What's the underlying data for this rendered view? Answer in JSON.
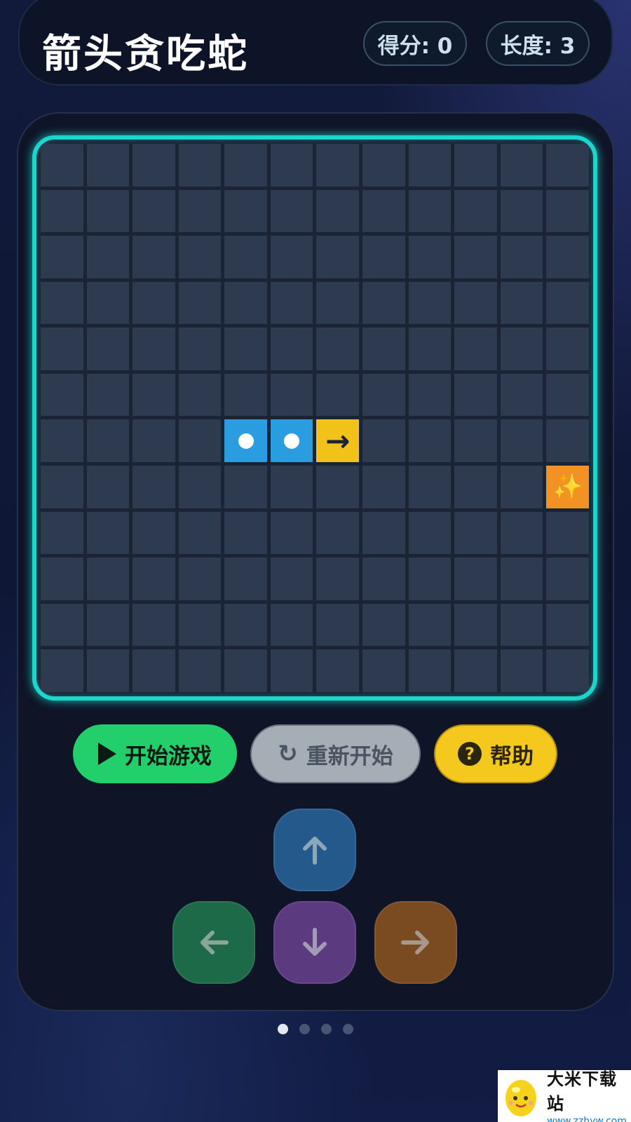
{
  "header": {
    "title": "箭头贪吃蛇",
    "score_text": "得分: 0",
    "length_text": "长度: 3"
  },
  "board": {
    "columns": 12,
    "rows": 12,
    "snake": [
      {
        "col": 4,
        "row": 6,
        "part": "body"
      },
      {
        "col": 5,
        "row": 6,
        "part": "body"
      },
      {
        "col": 6,
        "row": 6,
        "part": "head"
      }
    ],
    "head_direction": "→",
    "food": {
      "col": 11,
      "row": 7,
      "glyph": "✨"
    },
    "colors": {
      "border": "#1bd6cc",
      "cell": "#2d3a4f",
      "snake_body": "#2a9de0",
      "snake_head": "#f2c21a",
      "food": "#f39224"
    }
  },
  "controls": {
    "start_label": "开始游戏",
    "restart_label": "重新开始",
    "restart_icon": "↻",
    "help_label": "帮助",
    "help_icon": "?"
  },
  "dpad": {
    "up": "arrow-up-icon",
    "left": "arrow-left-icon",
    "down": "arrow-down-icon",
    "right": "arrow-right-icon"
  },
  "pagination": {
    "total": 4,
    "active": 0
  },
  "watermark": {
    "name": "大米下载站",
    "url": "www.zzhyw.com"
  }
}
